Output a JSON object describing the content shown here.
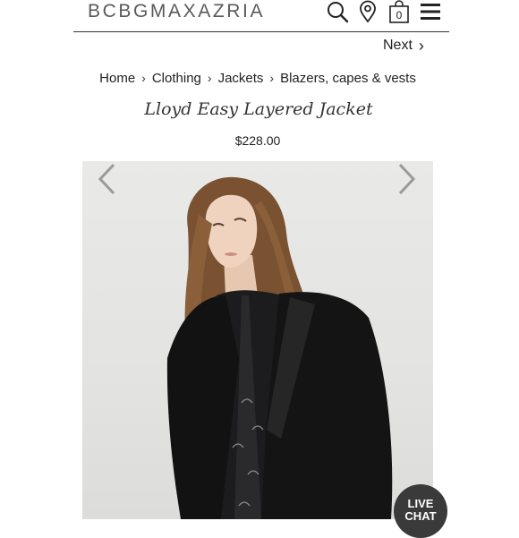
{
  "header": {
    "logo": "BCBGMAXAZRIA",
    "icons": [
      "search-icon",
      "location-pin-icon",
      "shopping-bag-icon",
      "menu-icon"
    ],
    "cart_count": "0"
  },
  "nav": {
    "next_label": "Next",
    "next_icon": "›"
  },
  "breadcrumb": {
    "items": [
      "Home",
      "Clothing",
      "Jackets",
      "Blazers, capes & vests"
    ],
    "separator": "›"
  },
  "product": {
    "title": "Lloyd Easy Layered Jacket",
    "price": "$228.00"
  },
  "gallery": {
    "prev_icon": "chevron-left-icon",
    "next_icon": "chevron-right-icon"
  },
  "chat": {
    "line1": "LIVE",
    "line2": "CHAT"
  },
  "colors": {
    "logo": "#5a5a5a",
    "chat_bg": "#3a3a3a",
    "photo_bg": "#e6e6e4"
  }
}
